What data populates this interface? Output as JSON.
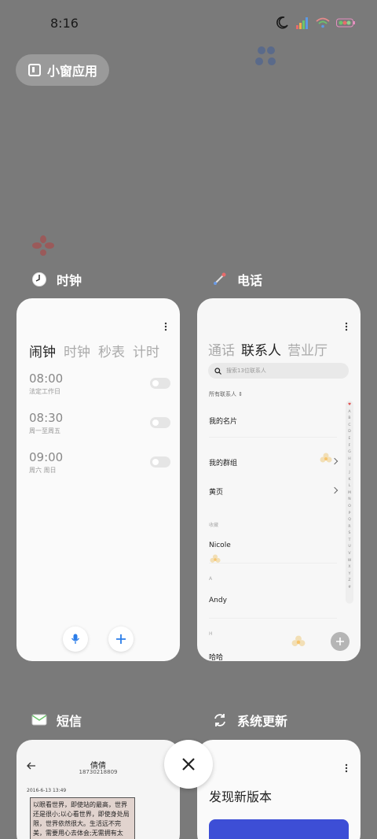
{
  "status_bar": {
    "time": "8:16",
    "icons": [
      "moon-icon",
      "cellular-signal-icon",
      "wifi-icon",
      "battery-icon"
    ]
  },
  "small_window_button": {
    "label": "小窗应用",
    "icon": "window-icon"
  },
  "apps": {
    "clock": {
      "title": "时钟",
      "icon": "clock-icon",
      "tabs": [
        "闹钟",
        "时钟",
        "秒表",
        "计时"
      ],
      "active_tab": "闹钟",
      "alarms": [
        {
          "time": "08:00",
          "repeat": "法定工作日",
          "enabled": false
        },
        {
          "time": "08:30",
          "repeat": "周一至周五",
          "enabled": false
        },
        {
          "time": "09:00",
          "repeat": "周六 周日",
          "enabled": false
        }
      ]
    },
    "phone": {
      "title": "电话",
      "icon": "phone-icon",
      "tabs": [
        "通话",
        "联系人",
        "营业厅"
      ],
      "active_tab": "联系人",
      "search_placeholder": "搜索13位联系人",
      "filter_label": "所有联系人",
      "rows": {
        "my_card": "我的名片",
        "my_groups": "我的群组",
        "yellow_pages": "黄页"
      },
      "sections": {
        "favorites": "收藏",
        "a": "A",
        "h": "H"
      },
      "contacts": {
        "nicole": "Nicole",
        "andy": "Andy",
        "haha": "哈哈"
      },
      "alphabet": [
        "♥",
        "A",
        "B",
        "C",
        "D",
        "E",
        "F",
        "G",
        "H",
        "I",
        "J",
        "K",
        "L",
        "M",
        "N",
        "O",
        "P",
        "Q",
        "R",
        "S",
        "T",
        "U",
        "V",
        "W",
        "X",
        "Y",
        "Z",
        "#"
      ]
    },
    "messages": {
      "title": "短信",
      "icon": "message-icon",
      "contact_name": "倩倩",
      "contact_number": "18730218809",
      "date": "2016-6-13 13:49",
      "body": "以眼看世界，即使站的最高，世界还是很小;以心看世界，即使身处局限，世界依然很大。生活远不完美，需要用心去体会;无需拥有太"
    },
    "system_update": {
      "title": "系统更新",
      "icon": "refresh-icon",
      "heading": "发现新版本"
    }
  },
  "colors": {
    "background": "#7a7a7a",
    "accent_blue": "#2b7de9",
    "update_banner": "#3d4ed6"
  }
}
